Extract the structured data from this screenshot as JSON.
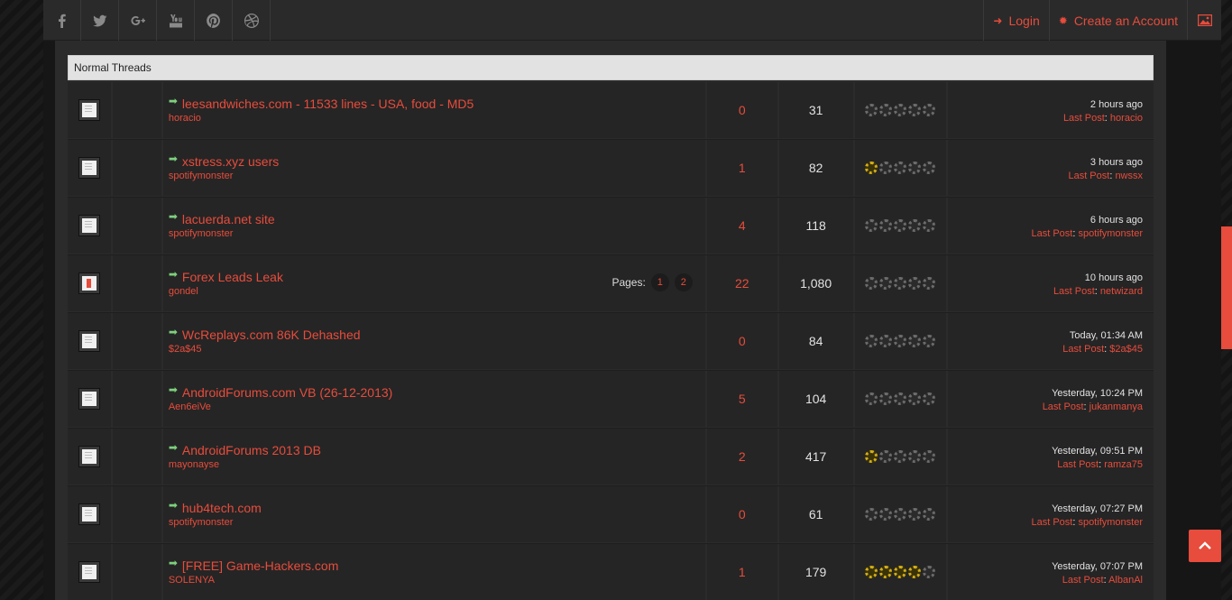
{
  "topbar": {
    "social": [
      {
        "name": "facebook-icon",
        "glyph": "f"
      },
      {
        "name": "twitter-icon",
        "glyph": "t"
      },
      {
        "name": "google-plus-icon",
        "glyph": "g+"
      },
      {
        "name": "youtube-icon",
        "glyph": "yt"
      },
      {
        "name": "pinterest-icon",
        "glyph": "p"
      },
      {
        "name": "dribbble-icon",
        "glyph": "d"
      }
    ],
    "login_label": "Login",
    "create_account_label": "Create an Account"
  },
  "section": {
    "title": "Normal Threads"
  },
  "threads": [
    {
      "title": "leesandwiches.com - 11533 lines - USA, food - MD5",
      "author": "horacio",
      "replies": "0",
      "views": "31",
      "rating": 0,
      "time": "2 hours ago",
      "last_label": "Last Post",
      "last_user": "horacio",
      "icon": "doc"
    },
    {
      "title": "xstress.xyz users",
      "author": "spotifymonster",
      "replies": "1",
      "views": "82",
      "rating": 1,
      "time": "3 hours ago",
      "last_label": "Last Post",
      "last_user": "nwssx",
      "icon": "doc"
    },
    {
      "title": "lacuerda.net site",
      "author": "spotifymonster",
      "replies": "4",
      "views": "118",
      "rating": 0,
      "time": "6 hours ago",
      "last_label": "Last Post",
      "last_user": "spotifymonster",
      "icon": "doc"
    },
    {
      "title": "Forex Leads Leak",
      "author": "gondel",
      "replies": "22",
      "views": "1,080",
      "rating": 0,
      "time": "10 hours ago",
      "last_label": "Last Post",
      "last_user": "netwizard",
      "icon": "hot",
      "pages_label": "Pages:",
      "pages": [
        "1",
        "2"
      ]
    },
    {
      "title": "WcReplays.com 86K Dehashed",
      "author": "$2a$45",
      "replies": "0",
      "views": "84",
      "rating": 0,
      "time": "Today, 01:34 AM",
      "last_label": "Last Post",
      "last_user": "$2a$45",
      "icon": "doc"
    },
    {
      "title": "AndroidForums.com VB (26-12-2013)",
      "author": "Aen6eiVe",
      "replies": "5",
      "views": "104",
      "rating": 0,
      "time": "Yesterday, 10:24 PM",
      "last_label": "Last Post",
      "last_user": "jukanmanya",
      "icon": "doc"
    },
    {
      "title": "AndroidForums 2013 DB",
      "author": "mayonayse",
      "replies": "2",
      "views": "417",
      "rating": 1,
      "time": "Yesterday, 09:51 PM",
      "last_label": "Last Post",
      "last_user": "ramza75",
      "icon": "doc"
    },
    {
      "title": "hub4tech.com",
      "author": "spotifymonster",
      "replies": "0",
      "views": "61",
      "rating": 0,
      "time": "Yesterday, 07:27 PM",
      "last_label": "Last Post",
      "last_user": "spotifymonster",
      "icon": "doc"
    },
    {
      "title": "[FREE] Game-Hackers.com",
      "author": "SOLENYA",
      "replies": "1",
      "views": "179",
      "rating": 4,
      "time": "Yesterday, 07:07 PM",
      "last_label": "Last Post",
      "last_user": "AlbanAl",
      "icon": "doc"
    }
  ],
  "colors": {
    "accent": "#e74c3c",
    "star_on": "#d4ae14",
    "arrow": "#7ed07e"
  }
}
